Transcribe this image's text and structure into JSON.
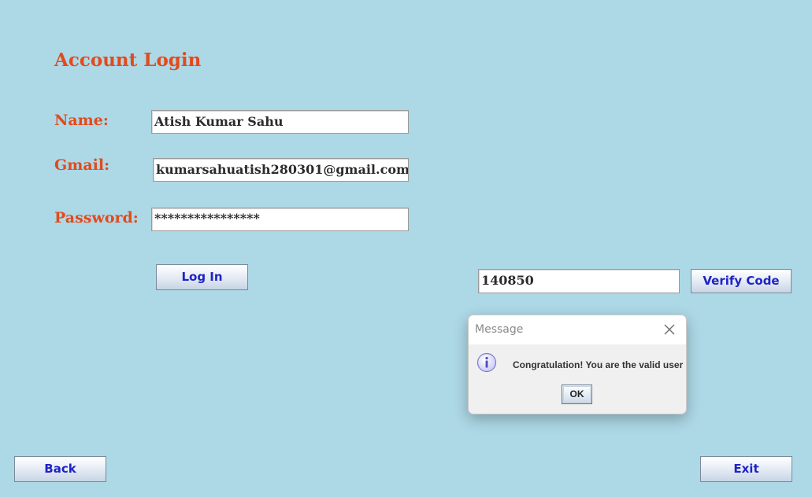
{
  "form": {
    "title": "Account Login",
    "name_label": "Name:",
    "name_value": "Atish Kumar Sahu",
    "gmail_label": "Gmail:",
    "gmail_value": "kumarsahuatish280301@gmail.com",
    "password_label": "Password:",
    "password_value": "****************",
    "login_label": "Log In"
  },
  "verification": {
    "code_value": "140850",
    "verify_label": "Verify Code"
  },
  "footer": {
    "back_label": "Back",
    "exit_label": "Exit"
  },
  "dialog": {
    "title": "Message",
    "icon": "info-icon",
    "message": "Congratulation! You are the valid user",
    "ok_label": "OK"
  },
  "colors": {
    "background": "#add8e6",
    "label_accent": "#e34a1c",
    "button_text": "#1f23c6"
  }
}
